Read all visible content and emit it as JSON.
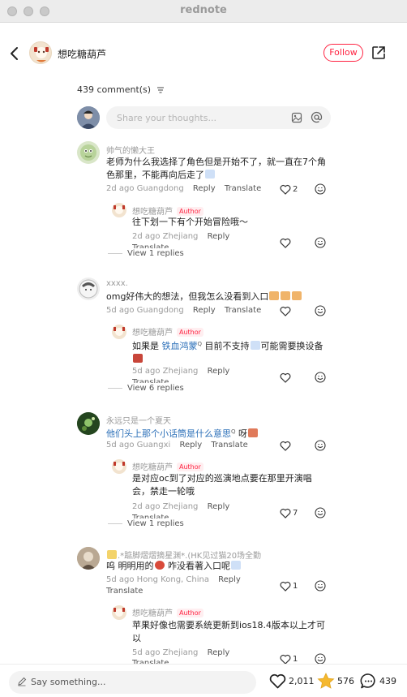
{
  "window": {
    "title": "rednote"
  },
  "header": {
    "author_name": "想吃糖葫芦",
    "follow_label": "Follow"
  },
  "comments_header": {
    "count_label": "439 comment(s)"
  },
  "composer": {
    "placeholder": "Share your thoughts..."
  },
  "comments": [
    {
      "user": "帅气的懒大王",
      "text": "老师为什么我选择了角色但是开始不了，就一直在7个角色那里，不能再向后走了",
      "date": "2d ago",
      "location": "Guangdong",
      "reply": "Reply",
      "translate": "Translate",
      "likes": "2",
      "reply_item": {
        "user": "想吃糖葫芦",
        "badge": "Author",
        "text": "往下划一下有个开始冒险哦～",
        "date": "2d ago",
        "location": "Zhejiang",
        "reply": "Reply",
        "translate": "Translate"
      },
      "view_more": "View 1 replies"
    },
    {
      "user": "xxxx.",
      "text": "omg好伟大的想法，但我怎么没看到入口",
      "date": "5d ago",
      "location": "Guangdong",
      "reply": "Reply",
      "translate": "Translate",
      "reply_item": {
        "user": "想吃糖葫芦",
        "badge": "Author",
        "text_a": "如果是 ",
        "text_link": "铁血鸿蒙",
        "text_b": " 目前不支持",
        "text_c": "可能需要换设备",
        "date": "5d ago",
        "location": "Zhejiang",
        "reply": "Reply",
        "translate": "Translate"
      },
      "view_more": "View 6 replies"
    },
    {
      "user": "永远只是一个夏天",
      "text_a": "他们头上那个小话筒是什么意思",
      "text_b": " 呀",
      "date": "5d ago",
      "location": "Guangxi",
      "reply": "Reply",
      "translate": "Translate",
      "reply_item": {
        "user": "想吃糖葫芦",
        "badge": "Author",
        "text": "是对应oc到了对应的巡演地点要在那里开演唱会，禁走一轮哦",
        "date": "2d ago",
        "location": "Zhejiang",
        "reply": "Reply",
        "translate": "Translate",
        "likes": "7"
      },
      "view_more": "View 1 replies"
    },
    {
      "user": ".*踮脚熠熠摘星渊*.(HK见过猫20场全勤",
      "text_a": "呜 明明用的",
      "text_b": " 咋没看著入口呢",
      "date": "5d ago",
      "location": "Hong Kong, China",
      "reply": "Reply",
      "translate": "Translate",
      "likes": "1",
      "reply_item": {
        "user": "想吃糖葫芦",
        "badge": "Author",
        "text": "苹果好像也需要系统更新到ios18.4版本以上才可以",
        "date": "5d ago",
        "location": "Zhejiang",
        "reply": "Reply",
        "translate": "Translate",
        "likes": "1"
      }
    }
  ],
  "bottom": {
    "placeholder": "Say something...",
    "likes": "2,011",
    "stars": "576",
    "comments": "439"
  },
  "colors": {
    "accent": "#ff2442",
    "link": "#2b6fb8",
    "muted": "#9a9a9a"
  },
  "icons": [
    "back-arrow-icon",
    "share-icon",
    "sort-icon",
    "image-icon",
    "at-icon",
    "heart-icon",
    "smile-icon",
    "pencil-icon",
    "star-icon",
    "comment-icon"
  ]
}
